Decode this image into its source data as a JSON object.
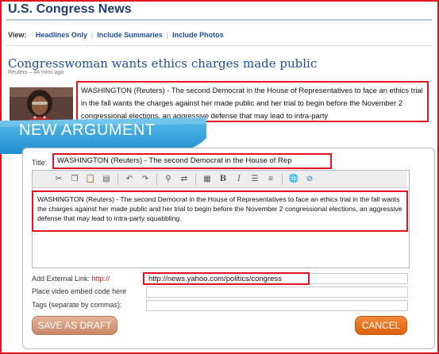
{
  "header": {
    "title": "U.S. Congress News"
  },
  "view_bar": {
    "label": "View:",
    "options": [
      "Headlines Only",
      "Include Summaries",
      "Include Photos"
    ]
  },
  "article": {
    "headline": "Congresswoman wants ethics charges made public",
    "byline": "Reuters – 44 mins ago",
    "snippet": "WASHINGTON (Reuters) - The second Democrat in the House of Representatives to face an ethics trial in the fall wants the charges against her made public and her trial to begin before the November 2 congressional elections, an aggressive defense that may lead to intra-party"
  },
  "form": {
    "banner": "NEW ARGUMENT",
    "title_label": "Title:",
    "title_value": "WASHINGTON (Reuters) - The second Democrat in the House of Rep",
    "body_text": "WASHINGTON (Reuters) - The second Democrat in the House of Representatives to face an ethics trial in the fall wants the charges against her made public and her trial to begin before the November 2 congressional elections, an aggressive defense that may lead to intra-party squabbling.",
    "external_link_label": "Add External Link:",
    "external_link_prefix": "http://",
    "external_link_value": "http://news.yahoo.com/politics/congress",
    "embed_label": "Place video embed code here",
    "tags_label": "Tags (separate by commas):",
    "save_draft_label": "SAVE AS DRAFT",
    "cancel_label": "CANCEL"
  },
  "toolbar_icons": [
    "cut-icon",
    "copy-icon",
    "paste-icon",
    "paste-text-icon",
    "undo-icon",
    "redo-icon",
    "find-icon",
    "replace-icon",
    "table-icon",
    "bold-icon",
    "italic-icon",
    "numbered-list-icon",
    "bullet-list-icon",
    "link-icon",
    "unlink-icon"
  ],
  "colors": {
    "accent_red": "#e0141e",
    "banner_blue": "#2a9bd8",
    "link_blue": "#1d4d9e",
    "cancel_orange": "#e86a1c"
  }
}
